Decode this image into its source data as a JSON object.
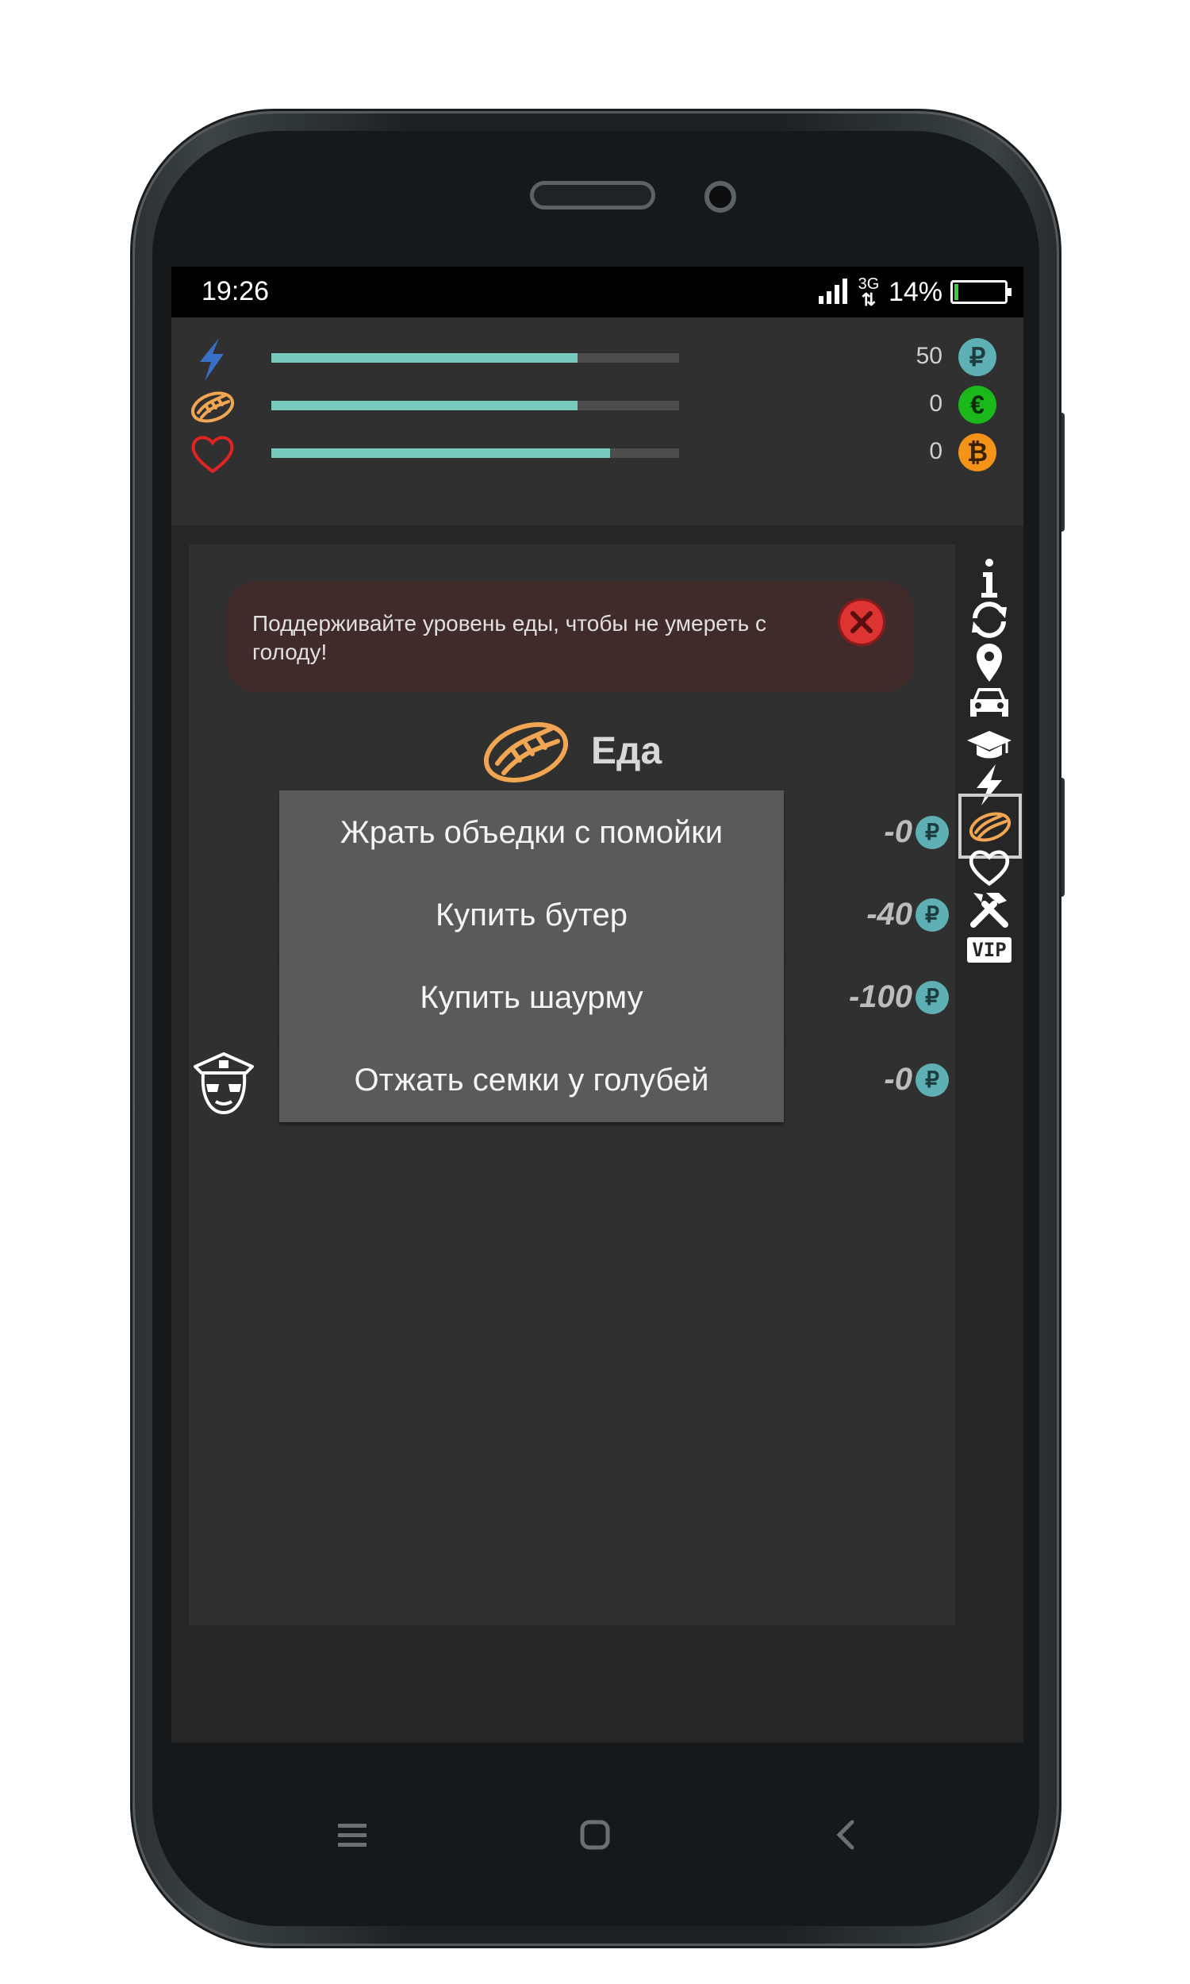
{
  "status_bar": {
    "time": "19:26",
    "network": "3G",
    "battery_pct": "14%",
    "battery_level": 0.14
  },
  "stats": {
    "bars": [
      {
        "icon": "lightning-icon",
        "level": 0.75,
        "color": "#78c9bd"
      },
      {
        "icon": "hotdog-icon",
        "level": 0.75,
        "color": "#78c9bd"
      },
      {
        "icon": "heart-icon",
        "level": 0.83,
        "color": "#78c9bd"
      }
    ],
    "currencies": [
      {
        "value": "50",
        "icon": "ruble-coin-icon",
        "symbol": "₽",
        "color": "#5fb0b4"
      },
      {
        "value": "0",
        "icon": "euro-coin-icon",
        "symbol": "€",
        "color": "#1bb81b"
      },
      {
        "value": "0",
        "icon": "bitcoin-coin-icon",
        "symbol": "₿",
        "color": "#f39418"
      }
    ]
  },
  "alert": {
    "text": "Поддерживайте уровень еды, чтобы не умереть с голоду!"
  },
  "section": {
    "title": "Еда",
    "icon": "hotdog-icon"
  },
  "actions": [
    {
      "label": "Жрать объедки с помойки",
      "price": "-0",
      "currency": "₽"
    },
    {
      "label": "Купить бутер",
      "price": "-40",
      "currency": "₽"
    },
    {
      "label": "Купить шаурму",
      "price": "-100",
      "currency": "₽"
    },
    {
      "label": "Отжать семки у голубей",
      "price": "-0",
      "currency": "₽",
      "badge_icon": "police-officer-icon"
    }
  ],
  "side_nav": [
    {
      "icon": "info-icon"
    },
    {
      "icon": "refresh-icon"
    },
    {
      "icon": "location-pin-icon"
    },
    {
      "icon": "car-icon"
    },
    {
      "icon": "graduation-cap-icon"
    },
    {
      "icon": "lightning-icon"
    },
    {
      "icon": "hotdog-icon",
      "active": true
    },
    {
      "icon": "heart-icon"
    },
    {
      "icon": "tools-icon"
    },
    {
      "icon": "vip-icon",
      "label": "VIP"
    }
  ],
  "colors": {
    "accent": "#78c9bd",
    "food": "#f0a652",
    "heart": "#e02424",
    "alert_bg": "#402a2a"
  }
}
